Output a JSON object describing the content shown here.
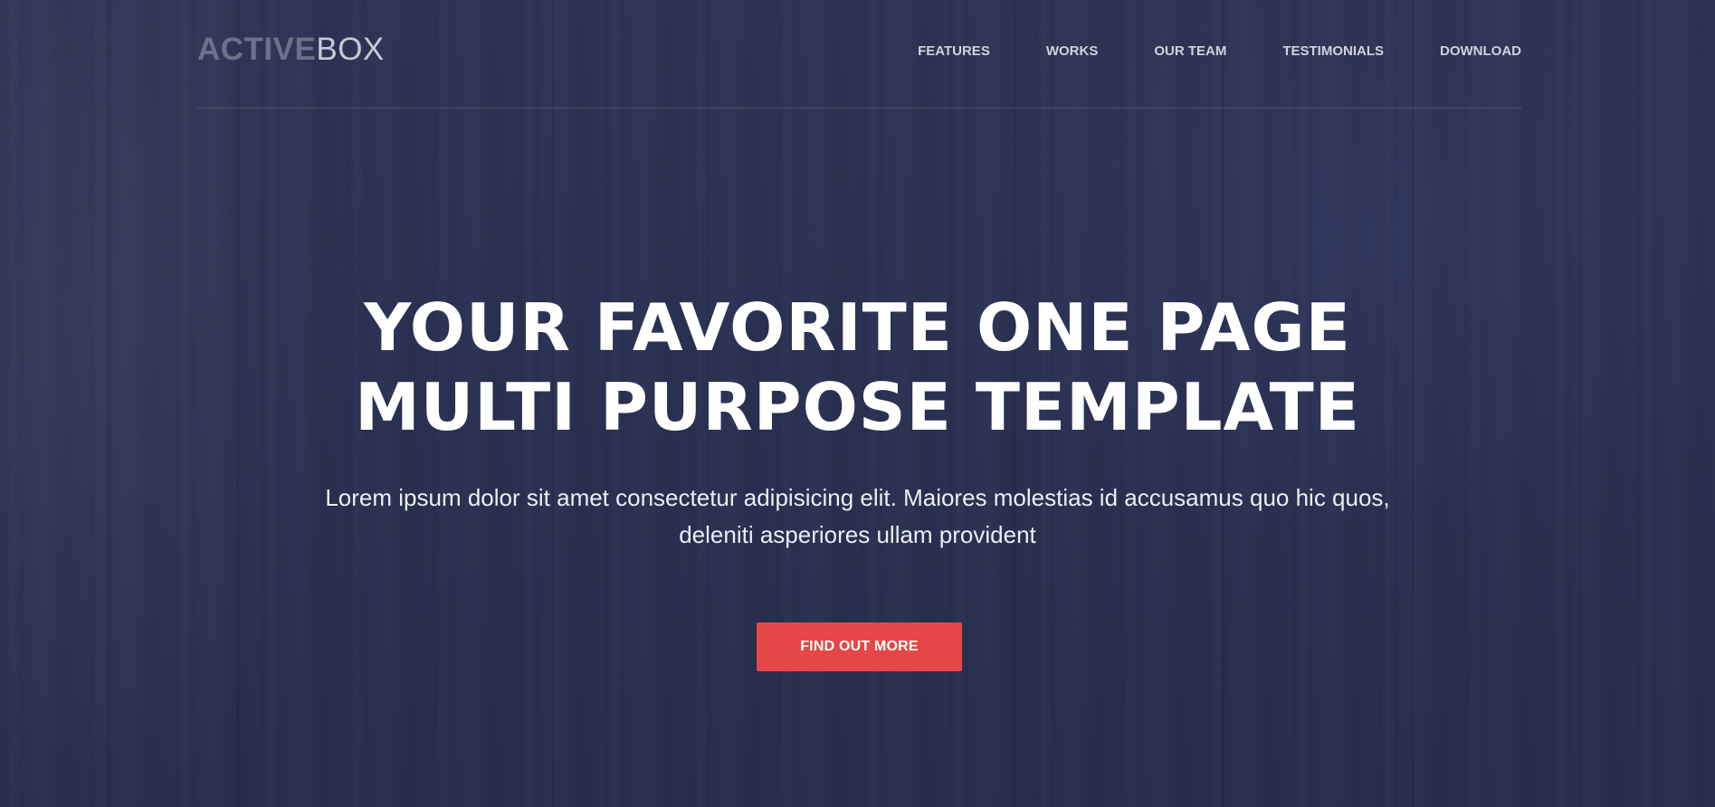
{
  "logo": {
    "part_bold": "ACTIVE",
    "part_light": "BOX"
  },
  "nav": {
    "items": [
      {
        "label": "FEATURES"
      },
      {
        "label": "WORKS"
      },
      {
        "label": "OUR TEAM"
      },
      {
        "label": "TESTIMONIALS"
      },
      {
        "label": "DOWNLOAD"
      }
    ]
  },
  "hero": {
    "headline_line1": "YOUR FAVORITE ONE PAGE",
    "headline_line2": "MULTI PURPOSE TEMPLATE",
    "subtext": "Lorem ipsum dolor sit amet consectetur adipisicing elit. Maiores molestias id accusamus quo hic quos, deleniti asperiores ullam provident",
    "cta_label": "FIND OUT MORE"
  },
  "colors": {
    "background": "#2b3152",
    "accent": "#e74646",
    "text": "#ffffff",
    "nav_text": "#d0d2dc"
  }
}
